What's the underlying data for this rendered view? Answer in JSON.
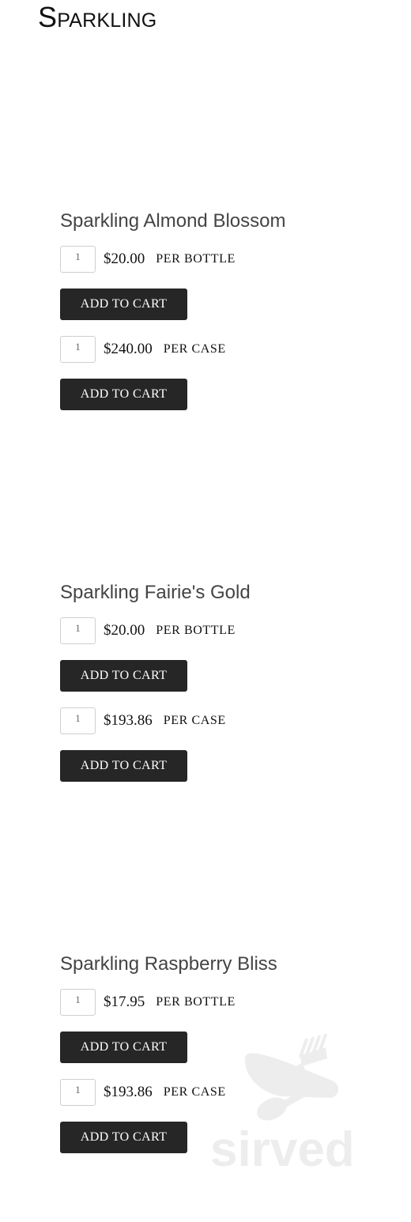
{
  "page": {
    "title": "Sparkling"
  },
  "products": [
    {
      "name": "Sparkling Almond Blossom",
      "options": [
        {
          "qty": "1",
          "price": "$20.00",
          "unit": "PER BOTTLE",
          "button": "ADD TO CART"
        },
        {
          "qty": "1",
          "price": "$240.00",
          "unit": "PER CASE",
          "button": "ADD TO CART"
        }
      ]
    },
    {
      "name": "Sparkling Fairie's Gold",
      "options": [
        {
          "qty": "1",
          "price": "$20.00",
          "unit": "PER BOTTLE",
          "button": "ADD TO CART"
        },
        {
          "qty": "1",
          "price": "$193.86",
          "unit": "PER CASE",
          "button": "ADD TO CART"
        }
      ]
    },
    {
      "name": "Sparkling Raspberry Bliss",
      "options": [
        {
          "qty": "1",
          "price": "$17.95",
          "unit": "PER BOTTLE",
          "button": "ADD TO CART"
        },
        {
          "qty": "1",
          "price": "$193.86",
          "unit": "PER CASE",
          "button": "ADD TO CART"
        }
      ]
    }
  ],
  "watermark": {
    "text": "sirved",
    "icon": "fork-spoon-knife-icon",
    "color": "#ededed"
  },
  "colors": {
    "button_bg": "#262626",
    "button_text": "#ffffff",
    "product_name": "#444444"
  }
}
